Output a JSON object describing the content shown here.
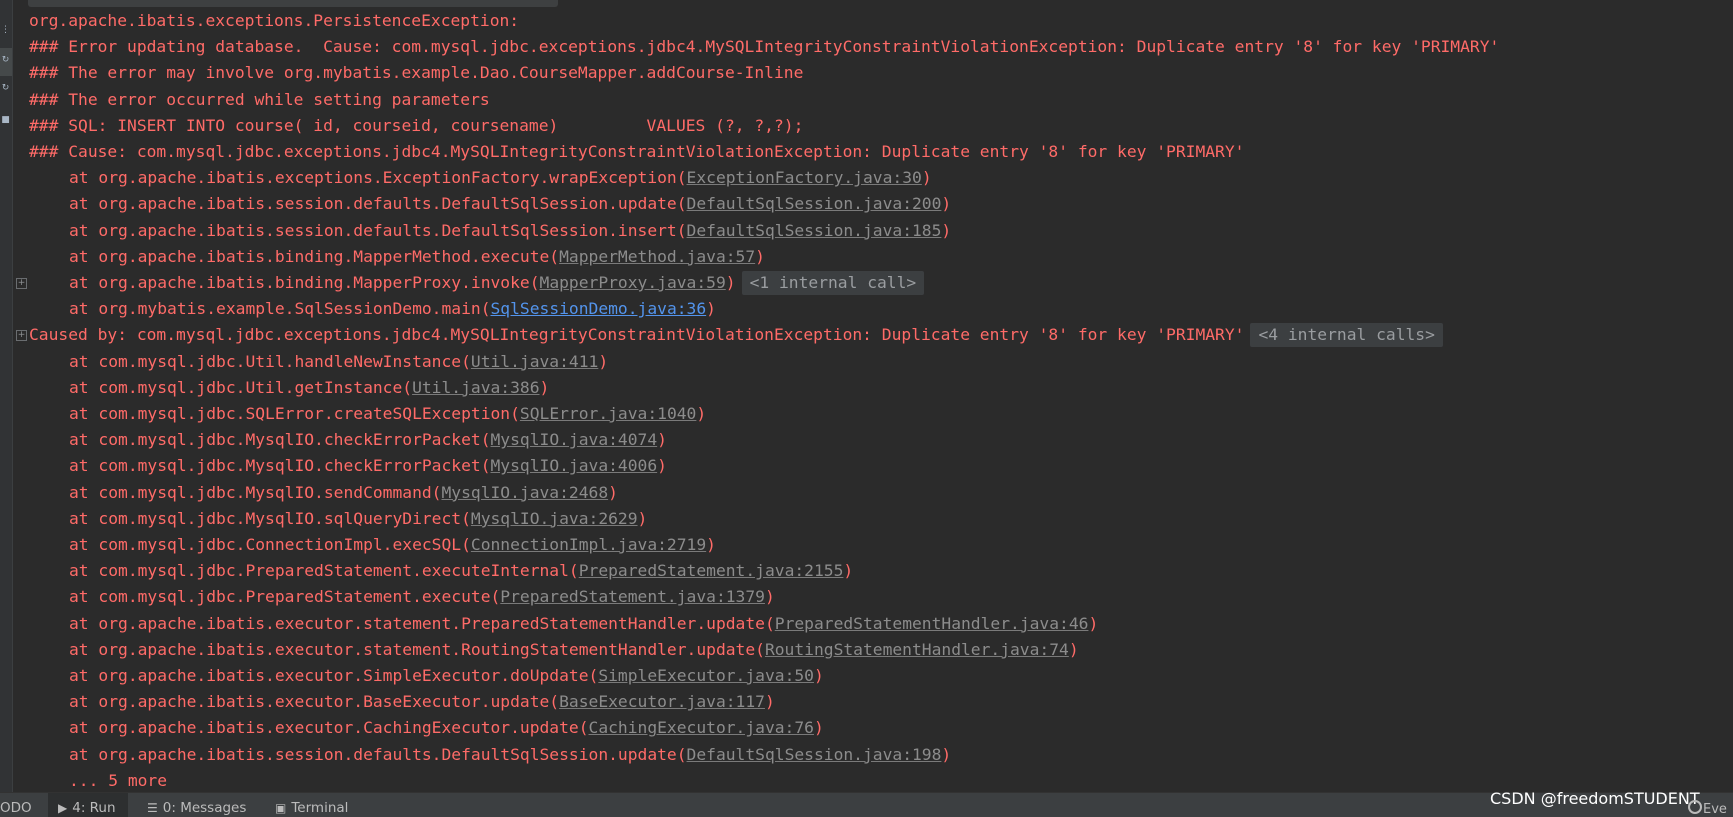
{
  "left_strip": {
    "buttons": [
      "⋮",
      "↻",
      "↻",
      "■"
    ]
  },
  "console": {
    "lines": [
      {
        "indent": false,
        "text": "org.apache.ibatis.exceptions.PersistenceException:"
      },
      {
        "indent": false,
        "text": "### Error updating database.  Cause: com.mysql.jdbc.exceptions.jdbc4.MySQLIntegrityConstraintViolationException: Duplicate entry '8' for key 'PRIMARY'"
      },
      {
        "indent": false,
        "text": "### The error may involve org.mybatis.example.Dao.CourseMapper.addCourse-Inline"
      },
      {
        "indent": false,
        "text": "### The error occurred while setting parameters"
      },
      {
        "indent": false,
        "text": "### SQL: INSERT INTO course( id, courseid, coursename)         VALUES (?, ?,?);"
      },
      {
        "indent": false,
        "text": "### Cause: com.mysql.jdbc.exceptions.jdbc4.MySQLIntegrityConstraintViolationException: Duplicate entry '8' for key 'PRIMARY'"
      },
      {
        "indent": true,
        "text": "at org.apache.ibatis.exceptions.ExceptionFactory.wrapException(",
        "link": "ExceptionFactory.java:30",
        "tail": ")"
      },
      {
        "indent": true,
        "text": "at org.apache.ibatis.session.defaults.DefaultSqlSession.update(",
        "link": "DefaultSqlSession.java:200",
        "tail": ")"
      },
      {
        "indent": true,
        "text": "at org.apache.ibatis.session.defaults.DefaultSqlSession.insert(",
        "link": "DefaultSqlSession.java:185",
        "tail": ")"
      },
      {
        "indent": true,
        "text": "at org.apache.ibatis.binding.MapperMethod.execute(",
        "link": "MapperMethod.java:57",
        "tail": ")"
      },
      {
        "indent": true,
        "text": "at org.apache.ibatis.binding.MapperProxy.invoke(",
        "link": "MapperProxy.java:59",
        "tail": ")",
        "pill": "<1 internal call>",
        "fold": true
      },
      {
        "indent": true,
        "text": "at org.mybatis.example.SqlSessionDemo.main(",
        "link": "SqlSessionDemo.java:36",
        "tail": ")",
        "link_active": true
      },
      {
        "indent": false,
        "text": "Caused by: com.mysql.jdbc.exceptions.jdbc4.MySQLIntegrityConstraintViolationException: Duplicate entry '8' for key 'PRIMARY'",
        "pill": "<4 internal calls>",
        "fold": true
      },
      {
        "indent": true,
        "text": "at com.mysql.jdbc.Util.handleNewInstance(",
        "link": "Util.java:411",
        "tail": ")"
      },
      {
        "indent": true,
        "text": "at com.mysql.jdbc.Util.getInstance(",
        "link": "Util.java:386",
        "tail": ")"
      },
      {
        "indent": true,
        "text": "at com.mysql.jdbc.SQLError.createSQLException(",
        "link": "SQLError.java:1040",
        "tail": ")"
      },
      {
        "indent": true,
        "text": "at com.mysql.jdbc.MysqlIO.checkErrorPacket(",
        "link": "MysqlIO.java:4074",
        "tail": ")"
      },
      {
        "indent": true,
        "text": "at com.mysql.jdbc.MysqlIO.checkErrorPacket(",
        "link": "MysqlIO.java:4006",
        "tail": ")"
      },
      {
        "indent": true,
        "text": "at com.mysql.jdbc.MysqlIO.sendCommand(",
        "link": "MysqlIO.java:2468",
        "tail": ")"
      },
      {
        "indent": true,
        "text": "at com.mysql.jdbc.MysqlIO.sqlQueryDirect(",
        "link": "MysqlIO.java:2629",
        "tail": ")"
      },
      {
        "indent": true,
        "text": "at com.mysql.jdbc.ConnectionImpl.execSQL(",
        "link": "ConnectionImpl.java:2719",
        "tail": ")"
      },
      {
        "indent": true,
        "text": "at com.mysql.jdbc.PreparedStatement.executeInternal(",
        "link": "PreparedStatement.java:2155",
        "tail": ")"
      },
      {
        "indent": true,
        "text": "at com.mysql.jdbc.PreparedStatement.execute(",
        "link": "PreparedStatement.java:1379",
        "tail": ")"
      },
      {
        "indent": true,
        "text": "at org.apache.ibatis.executor.statement.PreparedStatementHandler.update(",
        "link": "PreparedStatementHandler.java:46",
        "tail": ")"
      },
      {
        "indent": true,
        "text": "at org.apache.ibatis.executor.statement.RoutingStatementHandler.update(",
        "link": "RoutingStatementHandler.java:74",
        "tail": ")"
      },
      {
        "indent": true,
        "text": "at org.apache.ibatis.executor.SimpleExecutor.doUpdate(",
        "link": "SimpleExecutor.java:50",
        "tail": ")"
      },
      {
        "indent": true,
        "text": "at org.apache.ibatis.executor.BaseExecutor.update(",
        "link": "BaseExecutor.java:117",
        "tail": ")"
      },
      {
        "indent": true,
        "text": "at org.apache.ibatis.executor.CachingExecutor.update(",
        "link": "CachingExecutor.java:76",
        "tail": ")"
      },
      {
        "indent": true,
        "text": "at org.apache.ibatis.session.defaults.DefaultSqlSession.update(",
        "link": "DefaultSqlSession.java:198",
        "tail": ")"
      },
      {
        "indent": true,
        "text": "... 5 more"
      }
    ]
  },
  "bottom_bar": {
    "todo_label": "ODO",
    "run_label": "4: Run",
    "messages_label": "0: Messages",
    "terminal_label": "Terminal",
    "event_label": "Eve"
  },
  "watermark": "CSDN @freedomSTUDENT",
  "colors": {
    "error_text": "#ff6b68",
    "link": "#8c8c8c",
    "active_link": "#5394ec",
    "background": "#2b2b2b"
  }
}
